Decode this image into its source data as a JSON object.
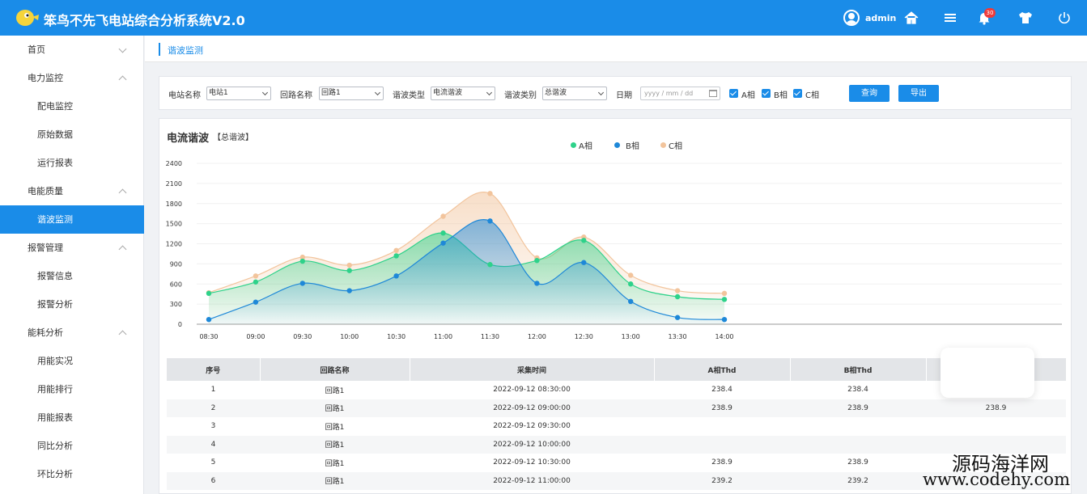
{
  "app": {
    "title": "笨鸟不先飞电站综合分析系统V2.0"
  },
  "header": {
    "username": "admin",
    "notification_count": "30"
  },
  "sidebar": {
    "items": [
      {
        "label": "首页",
        "type": "group",
        "chevron": "down"
      },
      {
        "label": "电力监控",
        "type": "group",
        "chevron": "up"
      },
      {
        "label": "配电监控",
        "type": "sub"
      },
      {
        "label": "原始数据",
        "type": "sub"
      },
      {
        "label": "运行报表",
        "type": "sub"
      },
      {
        "label": "电能质量",
        "type": "group",
        "chevron": "up"
      },
      {
        "label": "谐波监测",
        "type": "sub",
        "active": true
      },
      {
        "label": "报警管理",
        "type": "group",
        "chevron": "up"
      },
      {
        "label": "报警信息",
        "type": "sub"
      },
      {
        "label": "报警分析",
        "type": "sub"
      },
      {
        "label": "能耗分析",
        "type": "group",
        "chevron": "up"
      },
      {
        "label": "用能实况",
        "type": "sub"
      },
      {
        "label": "用能排行",
        "type": "sub"
      },
      {
        "label": "用能报表",
        "type": "sub"
      },
      {
        "label": "同比分析",
        "type": "sub"
      },
      {
        "label": "环比分析",
        "type": "sub"
      }
    ]
  },
  "breadcrumb": "谐波监测",
  "filters": {
    "station_label": "电站名称",
    "station_value": "电站1",
    "circuit_label": "回路名称",
    "circuit_value": "回路1",
    "harmonic_type_label": "谐波类型",
    "harmonic_type_value": "电流谐波",
    "harmonic_category_label": "谐波类别",
    "harmonic_category_value": "总谐波",
    "date_label": "日期",
    "date_placeholder": "yyyy / mm / dd",
    "phase_a": "A相",
    "phase_b": "B相",
    "phase_c": "C相",
    "query_button": "查询",
    "export_button": "导出"
  },
  "chart": {
    "title": "电流谐波",
    "subtitle": "【总谐波】",
    "colors": {
      "A": "#2ed28a",
      "B": "#1e88d8",
      "C": "#f2c49c"
    }
  },
  "chart_data": {
    "type": "area",
    "x": [
      "08:30",
      "09:00",
      "09:30",
      "10:00",
      "10:30",
      "11:00",
      "11:30",
      "12:00",
      "12:30",
      "13:00",
      "13:30",
      "14:00"
    ],
    "yticks": [
      0,
      300,
      600,
      900,
      1200,
      1500,
      1800,
      2100,
      2400
    ],
    "ylim": [
      0,
      2400
    ],
    "grid": true,
    "legend_position": "top-center",
    "series": [
      {
        "name": "A相",
        "values": [
          460,
          630,
          940,
          800,
          1020,
          1360,
          890,
          950,
          1250,
          600,
          410,
          370
        ]
      },
      {
        "name": "B相",
        "values": [
          70,
          330,
          610,
          500,
          720,
          1210,
          1540,
          610,
          920,
          340,
          100,
          70
        ]
      },
      {
        "name": "C相",
        "values": [
          470,
          720,
          1000,
          880,
          1100,
          1610,
          1950,
          990,
          1300,
          730,
          500,
          460
        ]
      }
    ]
  },
  "table": {
    "headers": [
      "序号",
      "回路名称",
      "采集时间",
      "A相Thd",
      "B相Thd",
      ""
    ],
    "rows": [
      [
        "1",
        "回路1",
        "2022-09-12 08:30:00",
        "238.4",
        "238.4",
        ""
      ],
      [
        "2",
        "回路1",
        "2022-09-12 09:00:00",
        "238.9",
        "238.9",
        "238.9"
      ],
      [
        "3",
        "回路1",
        "2022-09-12 09:30:00",
        "",
        "",
        ""
      ],
      [
        "4",
        "回路1",
        "2022-09-12 10:00:00",
        "",
        "",
        ""
      ],
      [
        "5",
        "回路1",
        "2022-09-12 10:30:00",
        "238.9",
        "238.9",
        ""
      ],
      [
        "6",
        "回路1",
        "2022-09-12 11:00:00",
        "239.2",
        "239.2",
        ""
      ]
    ]
  },
  "watermark": {
    "line1": "源码海洋网",
    "line2": "www.codehy.com"
  }
}
